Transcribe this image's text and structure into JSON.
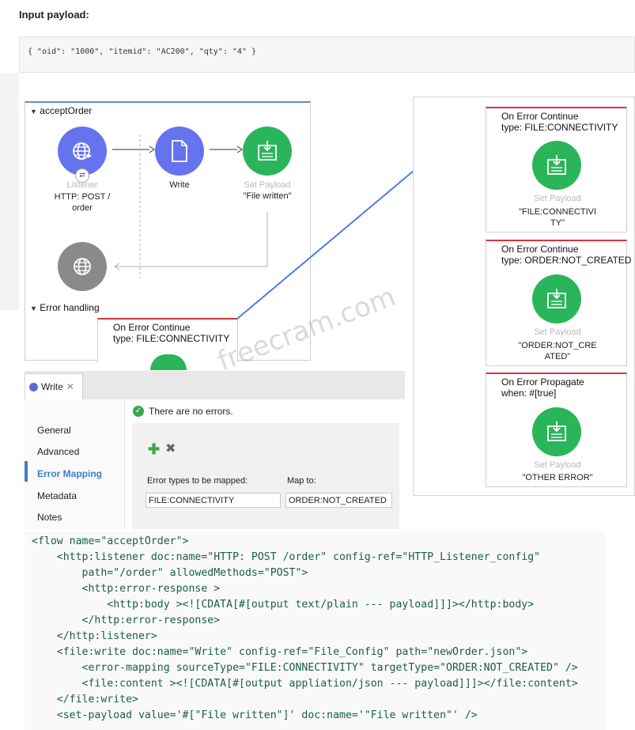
{
  "header": {
    "title": "Input payload:"
  },
  "payload": {
    "json": "{ \"oid\": \"1000\", \"itemid\": \"AC200\", \"qty\": \"4\" }"
  },
  "flow": {
    "name": "acceptOrder",
    "error_section": "Error handling",
    "listener": {
      "type": "Listener",
      "label": "HTTP: POST /\norder"
    },
    "write": {
      "label": "Write"
    },
    "set_payload": {
      "type": "Set Payload",
      "label": "\"File written\""
    },
    "error_card": {
      "line1": "On Error Continue",
      "line2": "type: FILE:CONNECTIVITY"
    }
  },
  "handlers": [
    {
      "line1": "On Error Continue",
      "line2": "type: FILE:CONNECTIVITY",
      "type": "Set Payload",
      "label": "\"FILE:CONNECTIVI\nTY\""
    },
    {
      "line1": "On Error Continue",
      "line2": "type: ORDER:NOT_CREATED",
      "type": "Set Payload",
      "label": "\"ORDER:NOT_CRE\nATED\""
    },
    {
      "line1": "On Error Propagate",
      "line2": "when: #[true]",
      "type": "Set Payload",
      "label": "\"OTHER ERROR\""
    }
  ],
  "properties": {
    "tab": "Write",
    "status": "There are no errors.",
    "sidebar": [
      "General",
      "Advanced",
      "Error Mapping",
      "Metadata",
      "Notes"
    ],
    "active_item": "Error Mapping",
    "col_error_types": "Error types to be mapped:",
    "col_map_to": "Map to:",
    "error_type_value": "FILE:CONNECTIVITY",
    "map_to_value": "ORDER:NOT_CREATED"
  },
  "watermark": "freecram.com",
  "code": [
    "<flow name=\"acceptOrder\">",
    "    <http:listener doc:name=\"HTTP: POST /order\" config-ref=\"HTTP_Listener_config\"",
    "        path=\"/order\" allowedMethods=\"POST\">",
    "        <http:error-response >",
    "            <http:body ><![CDATA[#[output text/plain --- payload]]]></http:body>",
    "        </http:error-response>",
    "    </http:listener>",
    "    <file:write doc:name=\"Write\" config-ref=\"File_Config\" path=\"newOrder.json\">",
    "        <error-mapping sourceType=\"FILE:CONNECTIVITY\" targetType=\"ORDER:NOT_CREATED\" />",
    "        <file:content ><![CDATA[#[output appliation/json --- payload]]]></file:content>",
    "    </file:write>",
    "    <set-payload value='#[\"File written\"]' doc:name='\"File written\"' />"
  ],
  "colors": {
    "accent_blue": "#5d8ed9",
    "error_red": "#d9333f",
    "node_blue": "#6673ee",
    "node_green": "#2bb55a",
    "active_link": "#3d7ec5"
  }
}
